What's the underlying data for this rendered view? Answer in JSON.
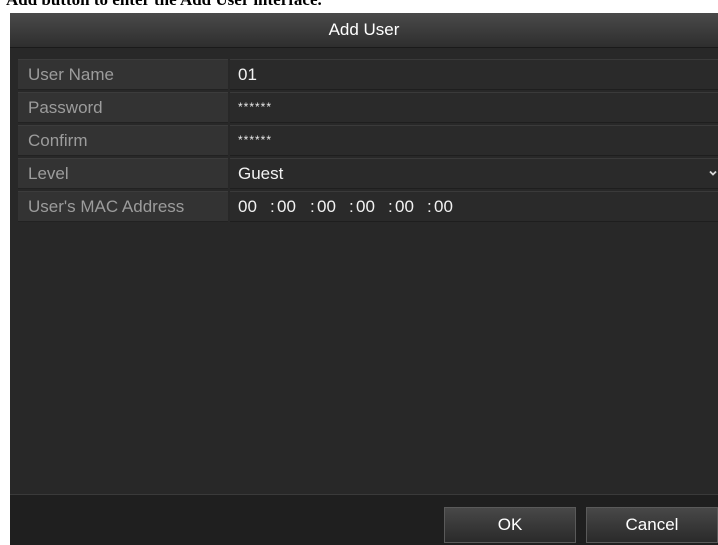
{
  "caption": "Add button to enter the Add User interface.",
  "dialog": {
    "title": "Add User"
  },
  "form": {
    "user_name": {
      "label": "User Name",
      "value": "01"
    },
    "password": {
      "label": "Password",
      "value": "******"
    },
    "confirm": {
      "label": "Confirm",
      "value": "******"
    },
    "level": {
      "label": "Level",
      "value": "Guest",
      "icon": "chevron-down-icon"
    },
    "mac": {
      "label": "User's MAC Address",
      "octets": [
        "00",
        "00",
        "00",
        "00",
        "00",
        "00"
      ],
      "separator": ":"
    }
  },
  "buttons": {
    "ok": "OK",
    "cancel": "Cancel"
  },
  "colors": {
    "dialog_bg": "#282828",
    "label_text": "#9c9c9c",
    "value_text": "#f2f2f2"
  }
}
